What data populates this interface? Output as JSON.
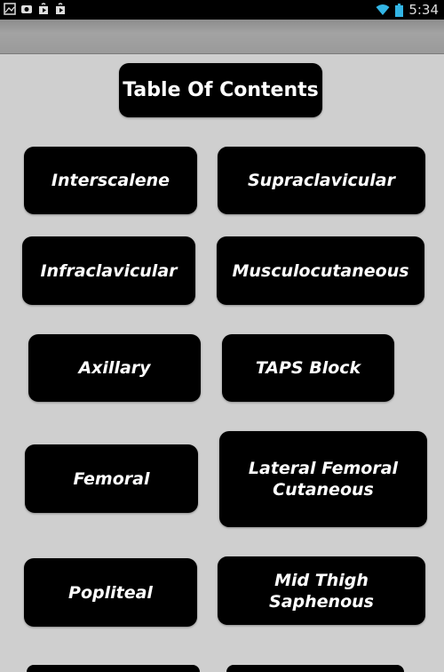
{
  "status_bar": {
    "time": "5:34",
    "icons": [
      "image-icon",
      "camera-icon",
      "play-store-icon",
      "play-store-icon"
    ]
  },
  "title_button": {
    "label": "Table Of Contents"
  },
  "menu": [
    {
      "label": "Interscalene"
    },
    {
      "label": "Supraclavicular"
    },
    {
      "label": "Infraclavicular"
    },
    {
      "label": "Musculocutaneous"
    },
    {
      "label": "Axillary"
    },
    {
      "label": "TAPS Block"
    },
    {
      "label": "Femoral"
    },
    {
      "label": "Lateral Femoral Cutaneous"
    },
    {
      "label": "Popliteal"
    },
    {
      "label": "Mid Thigh Saphenous"
    }
  ]
}
